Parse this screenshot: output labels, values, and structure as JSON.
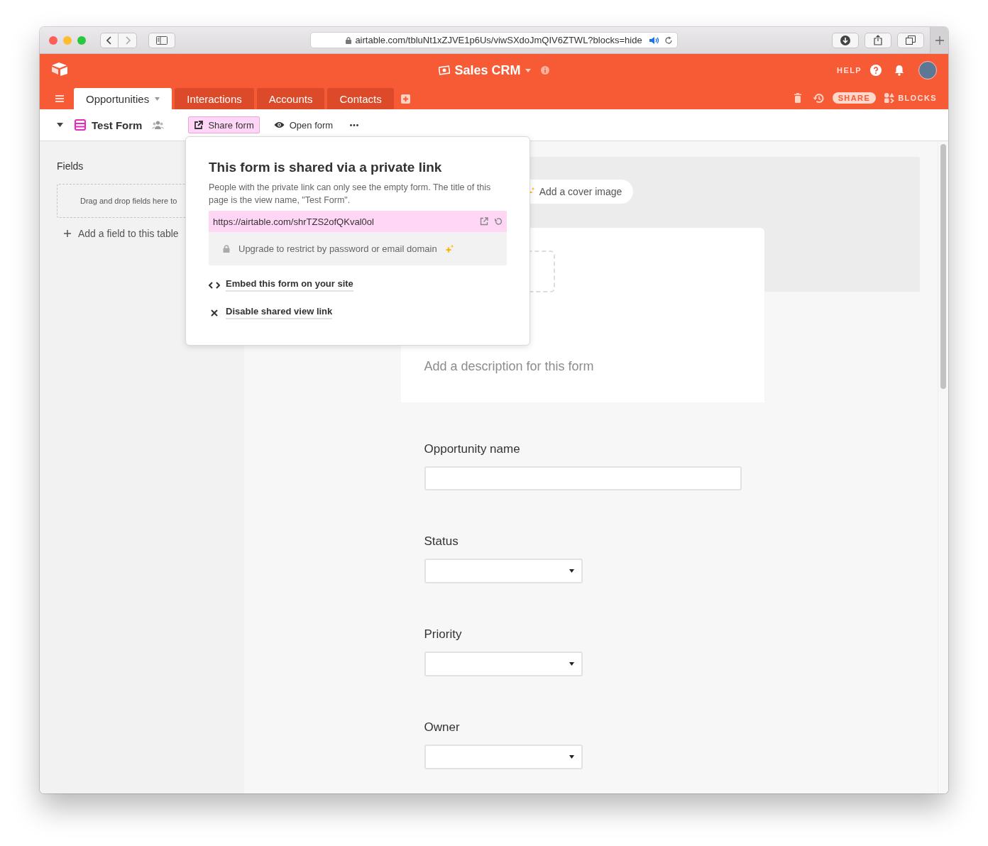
{
  "browser": {
    "url": "airtable.com/tbluNt1xZJVE1p6Us/viwSXdoJmQIV6ZTWL?blocks=hide"
  },
  "base": {
    "name": "Sales CRM",
    "help": "HELP"
  },
  "tabs": [
    {
      "label": "Opportunities",
      "selected": true
    },
    {
      "label": "Interactions",
      "selected": false
    },
    {
      "label": "Accounts",
      "selected": false
    },
    {
      "label": "Contacts",
      "selected": false
    }
  ],
  "table_actions": {
    "share": "SHARE",
    "blocks": "BLOCKS"
  },
  "view": {
    "name": "Test Form",
    "actions": [
      {
        "kind": "share",
        "label": "Share form",
        "selected": true
      },
      {
        "kind": "open",
        "label": "Open form",
        "selected": false
      }
    ]
  },
  "sidebar": {
    "title": "Fields",
    "drop_hint": "Drag and drop fields here to",
    "add_field": "Add a field to this table"
  },
  "share_popover": {
    "title": "This form is shared via a private link",
    "description": "People with the private link can only see the empty form. The title of this page is the view name, \"Test Form\".",
    "link": "https://airtable.com/shrTZS2ofQKval0ol",
    "upgrade": "Upgrade to restrict by password or email domain",
    "options": [
      {
        "kind": "embed",
        "label": "Embed this form on your site"
      },
      {
        "kind": "disable",
        "label": "Disable shared view link"
      }
    ]
  },
  "form": {
    "cover_button": "Add a cover image",
    "description_placeholder": "Add a description for this form",
    "fields": [
      {
        "kind": "text",
        "label": "Opportunity name"
      },
      {
        "kind": "select",
        "label": "Status"
      },
      {
        "kind": "select",
        "label": "Priority"
      },
      {
        "kind": "select",
        "label": "Owner"
      }
    ]
  }
}
